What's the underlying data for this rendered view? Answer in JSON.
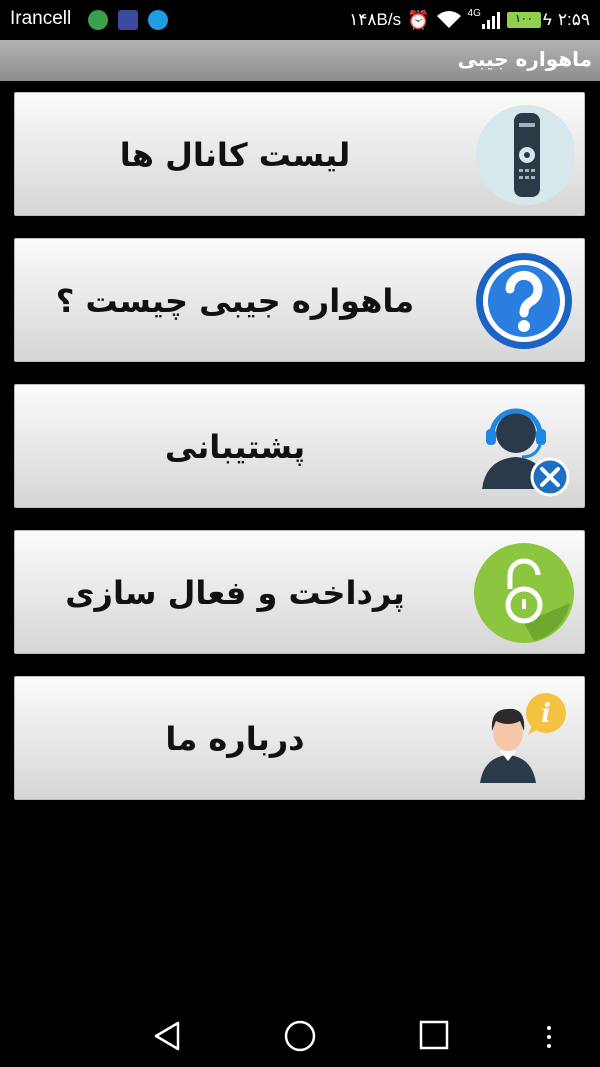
{
  "status_bar": {
    "carrier": "Irancell",
    "speed": "۱۴۸B/s",
    "network_type": "4G",
    "battery_level": "۱۰۰",
    "time": "۲:۵۹"
  },
  "action_bar": {
    "title": "ماهواره جیبی"
  },
  "menu": {
    "items": [
      {
        "label": "لیست کانال ها",
        "icon": "remote-control-icon"
      },
      {
        "label": "ماهواره جیبی چیست ؟",
        "icon": "question-icon"
      },
      {
        "label": "پشتیبانی",
        "icon": "support-headset-icon"
      },
      {
        "label": "پرداخت و فعال سازی",
        "icon": "unlock-icon"
      },
      {
        "label": "درباره ما",
        "icon": "about-info-icon"
      }
    ]
  },
  "colors": {
    "action_bar": "#9e9e9e",
    "button_light": "#fbfbfb",
    "button_dark": "#d6d6d6",
    "battery": "#8fd14f"
  }
}
